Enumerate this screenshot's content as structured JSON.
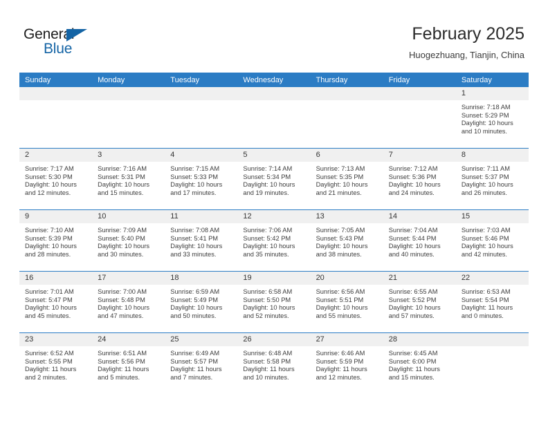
{
  "brand": {
    "name_part1": "General",
    "name_part2": "Blue",
    "accent_color": "#1464a5"
  },
  "header": {
    "title": "February 2025",
    "location": "Huogezhuang, Tianjin, China"
  },
  "theme": {
    "header_row_color": "#2b7cc4",
    "day_number_bg": "#f0f0f0",
    "grid_line_color": "#2b7cc4"
  },
  "calendar": {
    "weekday_headers": [
      "Sunday",
      "Monday",
      "Tuesday",
      "Wednesday",
      "Thursday",
      "Friday",
      "Saturday"
    ],
    "weeks": [
      [
        {
          "day": "",
          "empty": true
        },
        {
          "day": "",
          "empty": true
        },
        {
          "day": "",
          "empty": true
        },
        {
          "day": "",
          "empty": true
        },
        {
          "day": "",
          "empty": true
        },
        {
          "day": "",
          "empty": true
        },
        {
          "day": "1",
          "sunrise": "Sunrise: 7:18 AM",
          "sunset": "Sunset: 5:29 PM",
          "daylight1": "Daylight: 10 hours",
          "daylight2": "and 10 minutes."
        }
      ],
      [
        {
          "day": "2",
          "sunrise": "Sunrise: 7:17 AM",
          "sunset": "Sunset: 5:30 PM",
          "daylight1": "Daylight: 10 hours",
          "daylight2": "and 12 minutes."
        },
        {
          "day": "3",
          "sunrise": "Sunrise: 7:16 AM",
          "sunset": "Sunset: 5:31 PM",
          "daylight1": "Daylight: 10 hours",
          "daylight2": "and 15 minutes."
        },
        {
          "day": "4",
          "sunrise": "Sunrise: 7:15 AM",
          "sunset": "Sunset: 5:33 PM",
          "daylight1": "Daylight: 10 hours",
          "daylight2": "and 17 minutes."
        },
        {
          "day": "5",
          "sunrise": "Sunrise: 7:14 AM",
          "sunset": "Sunset: 5:34 PM",
          "daylight1": "Daylight: 10 hours",
          "daylight2": "and 19 minutes."
        },
        {
          "day": "6",
          "sunrise": "Sunrise: 7:13 AM",
          "sunset": "Sunset: 5:35 PM",
          "daylight1": "Daylight: 10 hours",
          "daylight2": "and 21 minutes."
        },
        {
          "day": "7",
          "sunrise": "Sunrise: 7:12 AM",
          "sunset": "Sunset: 5:36 PM",
          "daylight1": "Daylight: 10 hours",
          "daylight2": "and 24 minutes."
        },
        {
          "day": "8",
          "sunrise": "Sunrise: 7:11 AM",
          "sunset": "Sunset: 5:37 PM",
          "daylight1": "Daylight: 10 hours",
          "daylight2": "and 26 minutes."
        }
      ],
      [
        {
          "day": "9",
          "sunrise": "Sunrise: 7:10 AM",
          "sunset": "Sunset: 5:39 PM",
          "daylight1": "Daylight: 10 hours",
          "daylight2": "and 28 minutes."
        },
        {
          "day": "10",
          "sunrise": "Sunrise: 7:09 AM",
          "sunset": "Sunset: 5:40 PM",
          "daylight1": "Daylight: 10 hours",
          "daylight2": "and 30 minutes."
        },
        {
          "day": "11",
          "sunrise": "Sunrise: 7:08 AM",
          "sunset": "Sunset: 5:41 PM",
          "daylight1": "Daylight: 10 hours",
          "daylight2": "and 33 minutes."
        },
        {
          "day": "12",
          "sunrise": "Sunrise: 7:06 AM",
          "sunset": "Sunset: 5:42 PM",
          "daylight1": "Daylight: 10 hours",
          "daylight2": "and 35 minutes."
        },
        {
          "day": "13",
          "sunrise": "Sunrise: 7:05 AM",
          "sunset": "Sunset: 5:43 PM",
          "daylight1": "Daylight: 10 hours",
          "daylight2": "and 38 minutes."
        },
        {
          "day": "14",
          "sunrise": "Sunrise: 7:04 AM",
          "sunset": "Sunset: 5:44 PM",
          "daylight1": "Daylight: 10 hours",
          "daylight2": "and 40 minutes."
        },
        {
          "day": "15",
          "sunrise": "Sunrise: 7:03 AM",
          "sunset": "Sunset: 5:46 PM",
          "daylight1": "Daylight: 10 hours",
          "daylight2": "and 42 minutes."
        }
      ],
      [
        {
          "day": "16",
          "sunrise": "Sunrise: 7:01 AM",
          "sunset": "Sunset: 5:47 PM",
          "daylight1": "Daylight: 10 hours",
          "daylight2": "and 45 minutes."
        },
        {
          "day": "17",
          "sunrise": "Sunrise: 7:00 AM",
          "sunset": "Sunset: 5:48 PM",
          "daylight1": "Daylight: 10 hours",
          "daylight2": "and 47 minutes."
        },
        {
          "day": "18",
          "sunrise": "Sunrise: 6:59 AM",
          "sunset": "Sunset: 5:49 PM",
          "daylight1": "Daylight: 10 hours",
          "daylight2": "and 50 minutes."
        },
        {
          "day": "19",
          "sunrise": "Sunrise: 6:58 AM",
          "sunset": "Sunset: 5:50 PM",
          "daylight1": "Daylight: 10 hours",
          "daylight2": "and 52 minutes."
        },
        {
          "day": "20",
          "sunrise": "Sunrise: 6:56 AM",
          "sunset": "Sunset: 5:51 PM",
          "daylight1": "Daylight: 10 hours",
          "daylight2": "and 55 minutes."
        },
        {
          "day": "21",
          "sunrise": "Sunrise: 6:55 AM",
          "sunset": "Sunset: 5:52 PM",
          "daylight1": "Daylight: 10 hours",
          "daylight2": "and 57 minutes."
        },
        {
          "day": "22",
          "sunrise": "Sunrise: 6:53 AM",
          "sunset": "Sunset: 5:54 PM",
          "daylight1": "Daylight: 11 hours",
          "daylight2": "and 0 minutes."
        }
      ],
      [
        {
          "day": "23",
          "sunrise": "Sunrise: 6:52 AM",
          "sunset": "Sunset: 5:55 PM",
          "daylight1": "Daylight: 11 hours",
          "daylight2": "and 2 minutes."
        },
        {
          "day": "24",
          "sunrise": "Sunrise: 6:51 AM",
          "sunset": "Sunset: 5:56 PM",
          "daylight1": "Daylight: 11 hours",
          "daylight2": "and 5 minutes."
        },
        {
          "day": "25",
          "sunrise": "Sunrise: 6:49 AM",
          "sunset": "Sunset: 5:57 PM",
          "daylight1": "Daylight: 11 hours",
          "daylight2": "and 7 minutes."
        },
        {
          "day": "26",
          "sunrise": "Sunrise: 6:48 AM",
          "sunset": "Sunset: 5:58 PM",
          "daylight1": "Daylight: 11 hours",
          "daylight2": "and 10 minutes."
        },
        {
          "day": "27",
          "sunrise": "Sunrise: 6:46 AM",
          "sunset": "Sunset: 5:59 PM",
          "daylight1": "Daylight: 11 hours",
          "daylight2": "and 12 minutes."
        },
        {
          "day": "28",
          "sunrise": "Sunrise: 6:45 AM",
          "sunset": "Sunset: 6:00 PM",
          "daylight1": "Daylight: 11 hours",
          "daylight2": "and 15 minutes."
        },
        {
          "day": "",
          "empty": true
        }
      ]
    ]
  }
}
